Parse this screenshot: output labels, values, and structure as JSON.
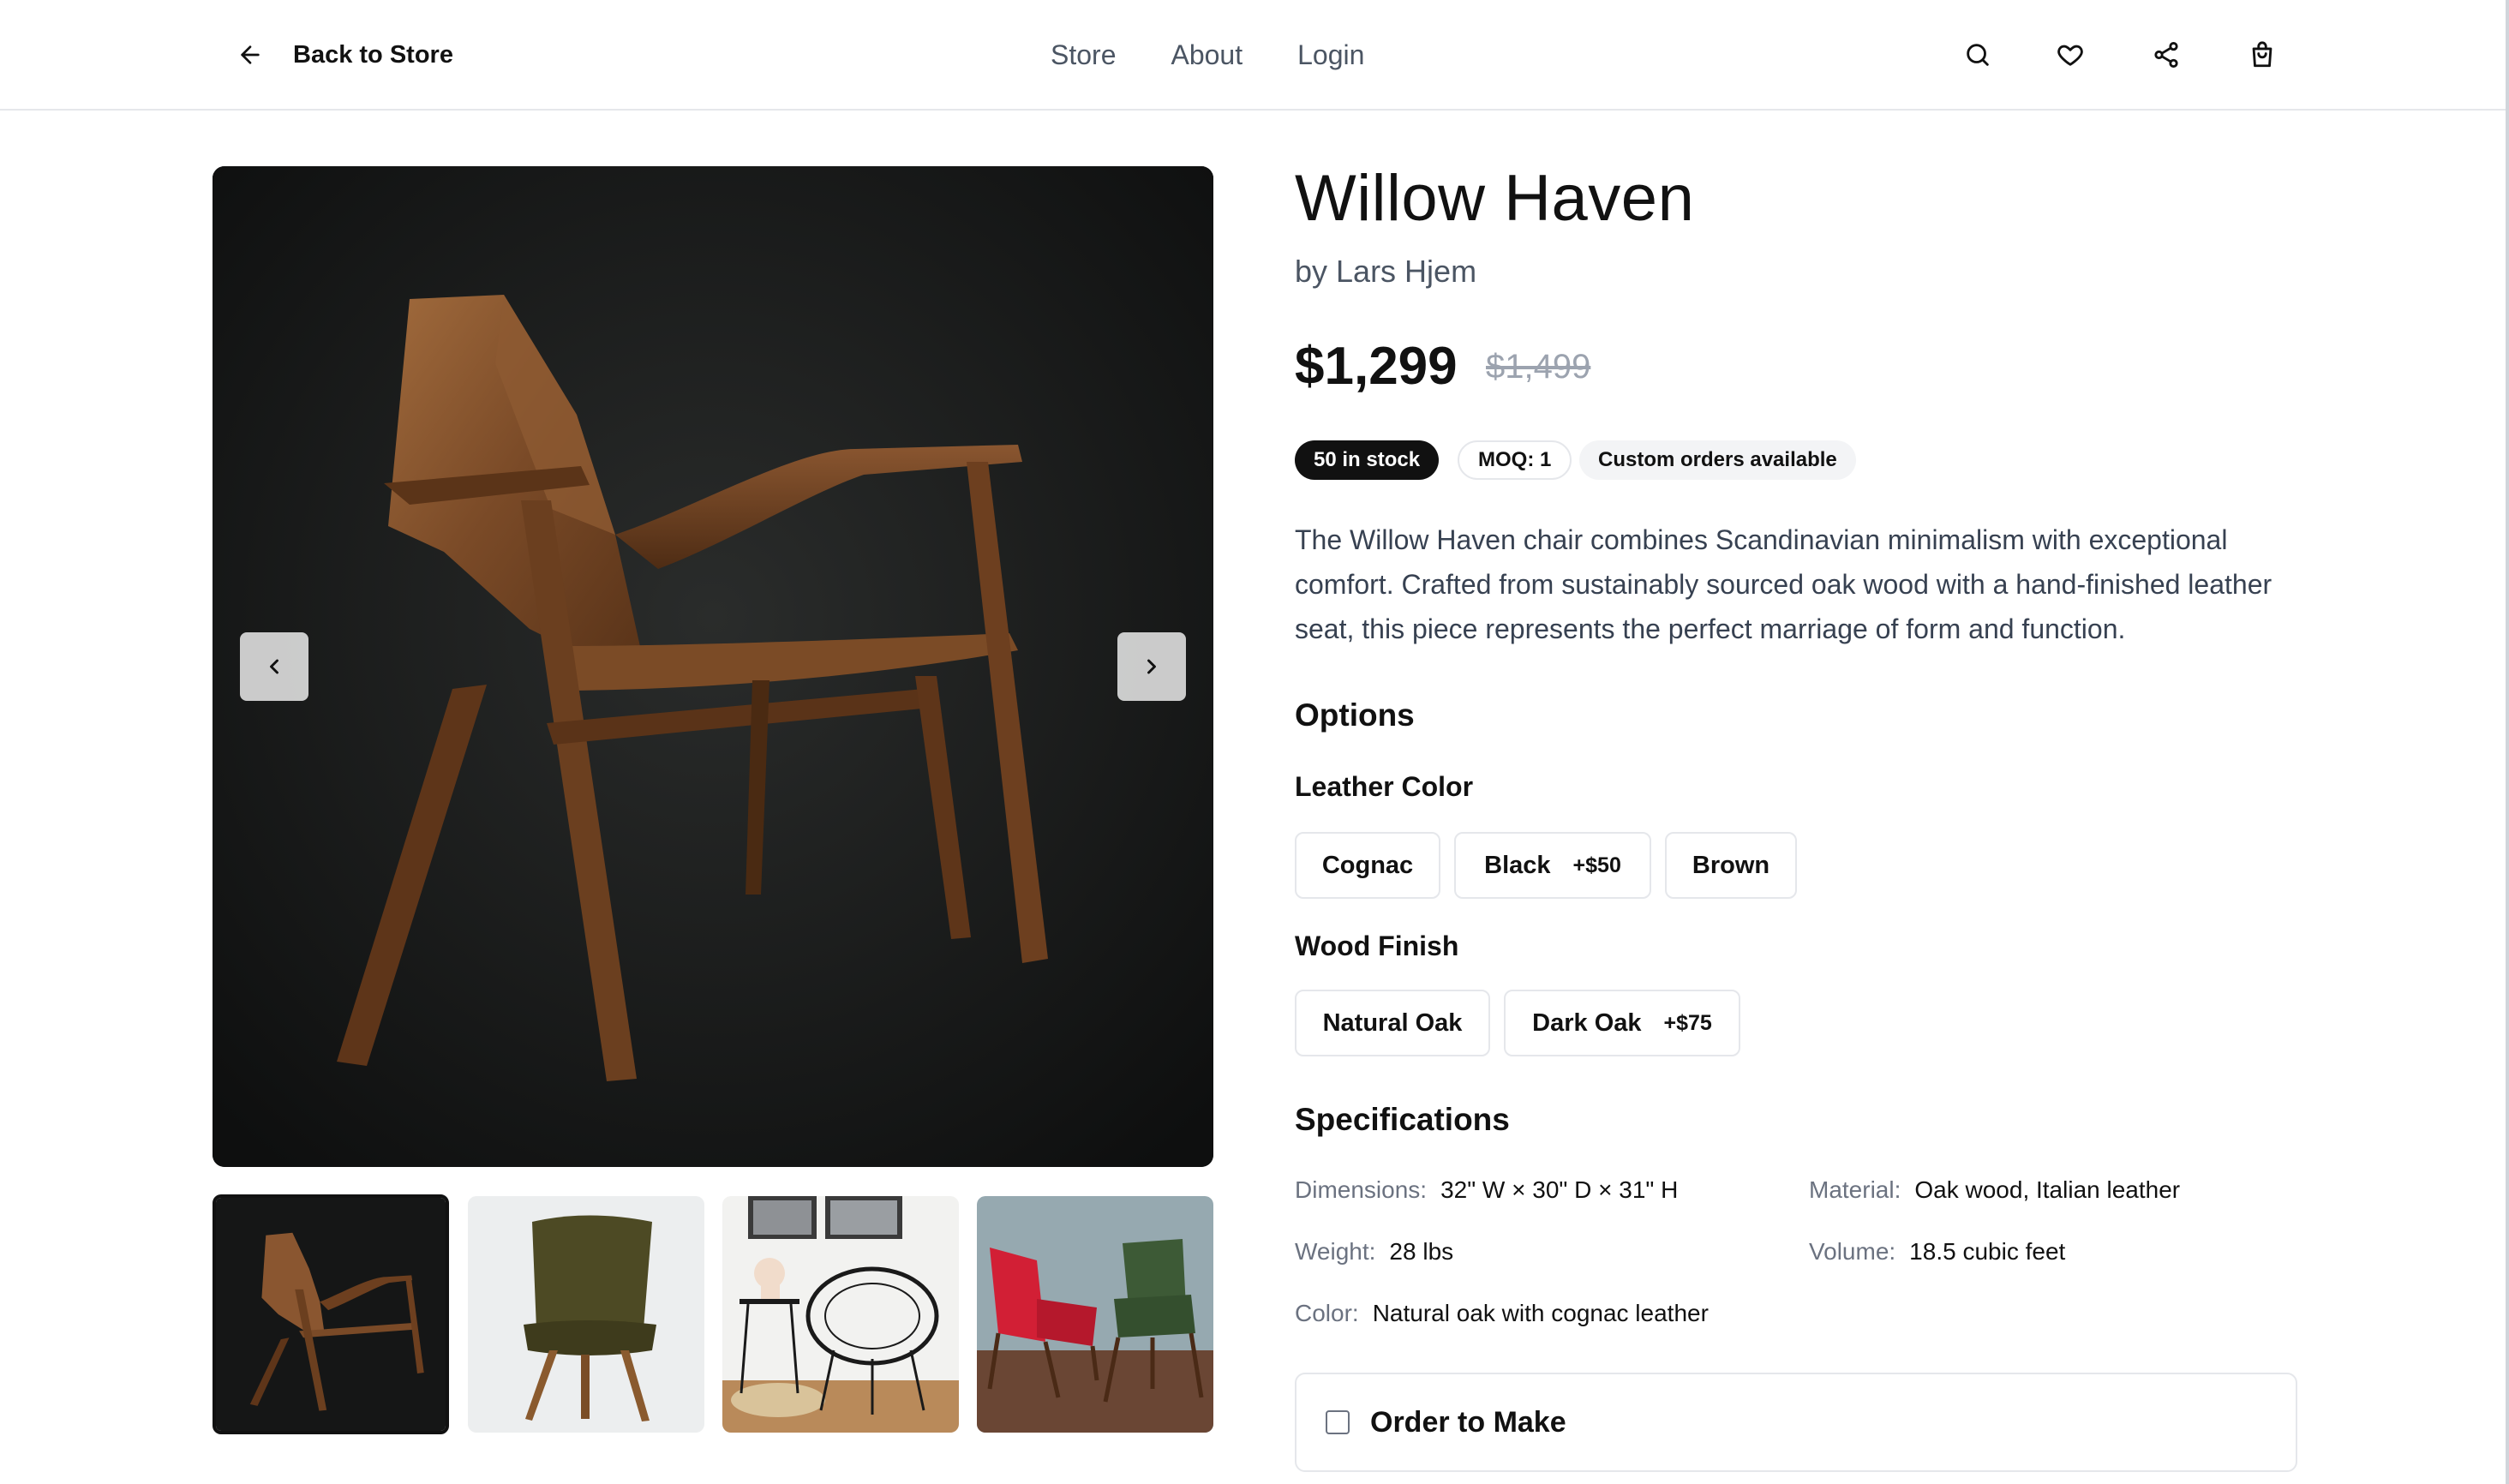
{
  "header": {
    "back_label": "Back to Store",
    "nav": [
      "Store",
      "About",
      "Login"
    ],
    "icons": [
      "search-icon",
      "heart-icon",
      "share-icon",
      "shopping-bag-icon"
    ]
  },
  "gallery": {
    "thumbnails": [
      "wood-lounge-chair",
      "olive-velvet-chair",
      "black-wire-chair",
      "red-and-green-armchairs"
    ],
    "active_index": 0
  },
  "product": {
    "name": "Willow Haven",
    "maker": "by Lars Hjem",
    "price": "$1,299",
    "old_price": "$1,499",
    "badges": [
      "50 in stock",
      "MOQ: 1",
      "Custom orders available"
    ],
    "description": "The Willow Haven chair combines Scandinavian minimalism with exceptional comfort. Crafted from sustainably sourced oak wood with a hand-finished leather seat, this piece represents the perfect marriage of form and function."
  },
  "options": {
    "heading": "Options",
    "leather": {
      "label": "Leather Color",
      "choices": [
        {
          "name": "Cognac",
          "extra": ""
        },
        {
          "name": "Black",
          "extra": "+$50"
        },
        {
          "name": "Brown",
          "extra": ""
        }
      ]
    },
    "wood": {
      "label": "Wood Finish",
      "choices": [
        {
          "name": "Natural Oak",
          "extra": ""
        },
        {
          "name": "Dark Oak",
          "extra": "+$75"
        }
      ]
    }
  },
  "specs": {
    "heading": "Specifications",
    "items": [
      {
        "key": "Dimensions:",
        "value": "32\" W × 30\" D × 31\" H"
      },
      {
        "key": "Material:",
        "value": "Oak wood, Italian leather"
      },
      {
        "key": "Weight:",
        "value": "28 lbs"
      },
      {
        "key": "Volume:",
        "value": "18.5 cubic feet"
      },
      {
        "key": "Color:",
        "value": "Natural oak with cognac leather"
      }
    ]
  },
  "order": {
    "label": "Order to Make",
    "checked": false
  }
}
